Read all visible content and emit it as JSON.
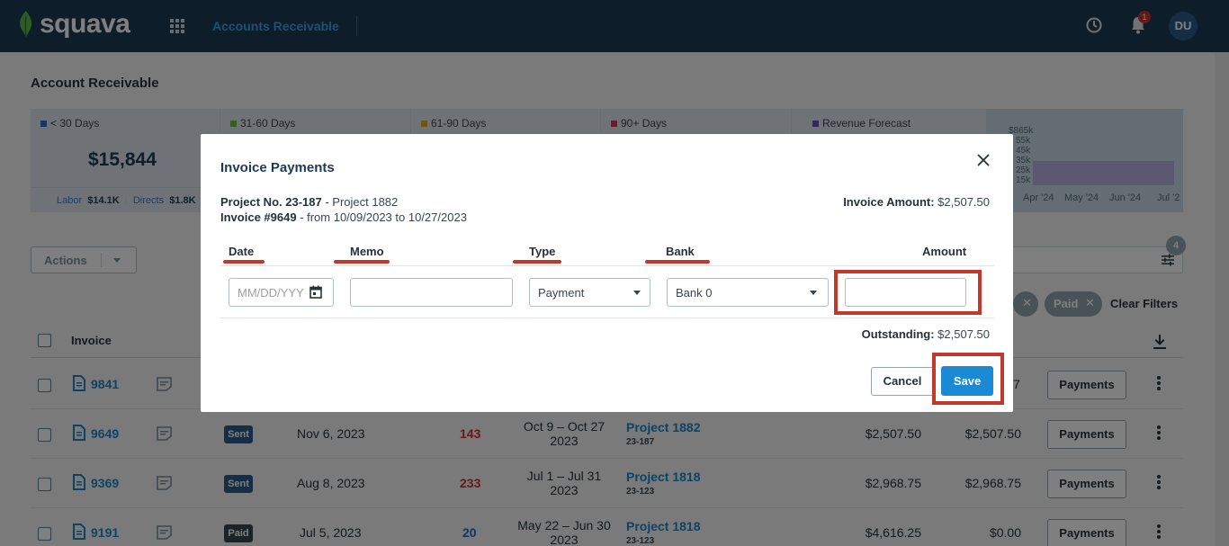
{
  "app": {
    "brand": "squava",
    "module": "Accounts Receivable",
    "notification_count": "1",
    "user_initials": "DU"
  },
  "page": {
    "title": "Account Receivable",
    "summary": [
      {
        "label": "< 30 Days",
        "color": "#2e6fd8",
        "value": "$15,844",
        "foot_labor_label": "Labor",
        "foot_labor": "$14.1K",
        "foot_directs_label": "Directs",
        "foot_directs": "$1.8K"
      },
      {
        "label": "31-60 Days",
        "color": "#6abf4b"
      },
      {
        "label": "61-90 Days",
        "color": "#e0a82e"
      },
      {
        "label": "90+ Days",
        "color": "#d63a4a"
      },
      {
        "label": "Revenue Forecast",
        "color": "#6a4fc8"
      }
    ],
    "forecast": {
      "y_ticks": [
        "$865k",
        "55k",
        "45k",
        "35k",
        "25k",
        "15k"
      ],
      "x_ticks": [
        "Apr '24",
        "May '24",
        "Jun '24",
        "Jul '2"
      ]
    },
    "actions_label": "Actions",
    "filter_count": "4",
    "chips": [
      "Paid"
    ],
    "clear_filters": "Clear Filters",
    "table_header": {
      "invoice": "Invoice"
    },
    "rows": [
      {
        "invoice": "9841",
        "amount2_tail": "7",
        "payments": "Payments"
      },
      {
        "invoice": "9649",
        "status": "Sent",
        "status_color": "#2c5d8a",
        "date": "Nov 6, 2023",
        "days": "143",
        "days_color": "#d32f2f",
        "period_1": "Oct 9 – Oct 27",
        "period_2": "2023",
        "project": "Project 1882",
        "project_no": "23-187",
        "amount": "$2,507.50",
        "outstanding": "$2,507.50",
        "payments": "Payments"
      },
      {
        "invoice": "9369",
        "status": "Sent",
        "status_color": "#2c5d8a",
        "date": "Aug 8, 2023",
        "days": "233",
        "days_color": "#d32f2f",
        "period_1": "Jul 1 – Jul 31",
        "period_2": "2023",
        "project": "Project 1818",
        "project_no": "23-123",
        "amount": "$2,968.75",
        "outstanding": "$2,968.75",
        "payments": "Payments"
      },
      {
        "invoice": "9191",
        "status": "Paid",
        "status_color": "#37474f",
        "date": "Jul 5, 2023",
        "days": "20",
        "days_color": "#1a6fc0",
        "period_1": "May 22 – Jun 30",
        "period_2": "2023",
        "project": "Project 1818",
        "project_no": "23-123",
        "amount": "$4,616.25",
        "outstanding": "$0.00",
        "payments": "Payments"
      }
    ]
  },
  "modal": {
    "title": "Invoice Payments",
    "project_label": "Project No. 23-187",
    "project_name": " - Project 1882",
    "invoice_label": "Invoice #9649",
    "invoice_range": " - from 10/09/2023 to 10/27/2023",
    "invoice_amount_label": "Invoice Amount:",
    "invoice_amount": " $2,507.50",
    "columns": {
      "date": "Date",
      "memo": "Memo",
      "type": "Type",
      "bank": "Bank",
      "amount": "Amount"
    },
    "date_placeholder": "MM/DD/YYY",
    "memo_value": "",
    "type_value": "Payment",
    "bank_value": "Bank 0",
    "amount_value": "",
    "outstanding_label": "Outstanding:",
    "outstanding": " $2,507.50",
    "cancel": "Cancel",
    "save": "Save"
  }
}
